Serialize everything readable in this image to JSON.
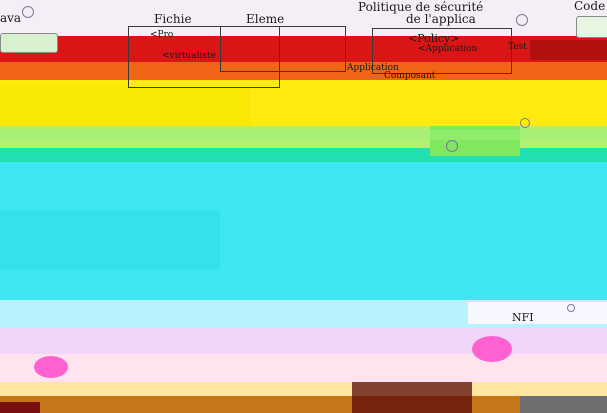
{
  "labels": {
    "java": "ava",
    "fichier": "Fichie",
    "element": "Eleme",
    "politique": "Politique de sécurité",
    "de_l_appli": "de l'applica",
    "code": "Code",
    "prog": "<Pro",
    "policy": "<Policy>",
    "application_tag": "<Application",
    "virtual": "<virtualiste",
    "application2": "Application",
    "composant": "Composant",
    "test": "Test",
    "nfi": "NFI"
  },
  "colors": {
    "top_bg": "#f2e6f5",
    "red_band": "#d81a1a",
    "orange_band": "#ff7a18",
    "yellow_band": "#ffee14",
    "green_band": "#aef25a",
    "teal_band": "#24e6b8",
    "cyan_band": "#3fe6f2",
    "lightcyan_band": "#b6f6ff",
    "lavender_band": "#f0d8f6",
    "magenta_band": "#ff6ed8",
    "pink_band": "#ffc7d2",
    "bottom_bg": "#ffffff",
    "dark_noise": "#7a0e0e"
  }
}
